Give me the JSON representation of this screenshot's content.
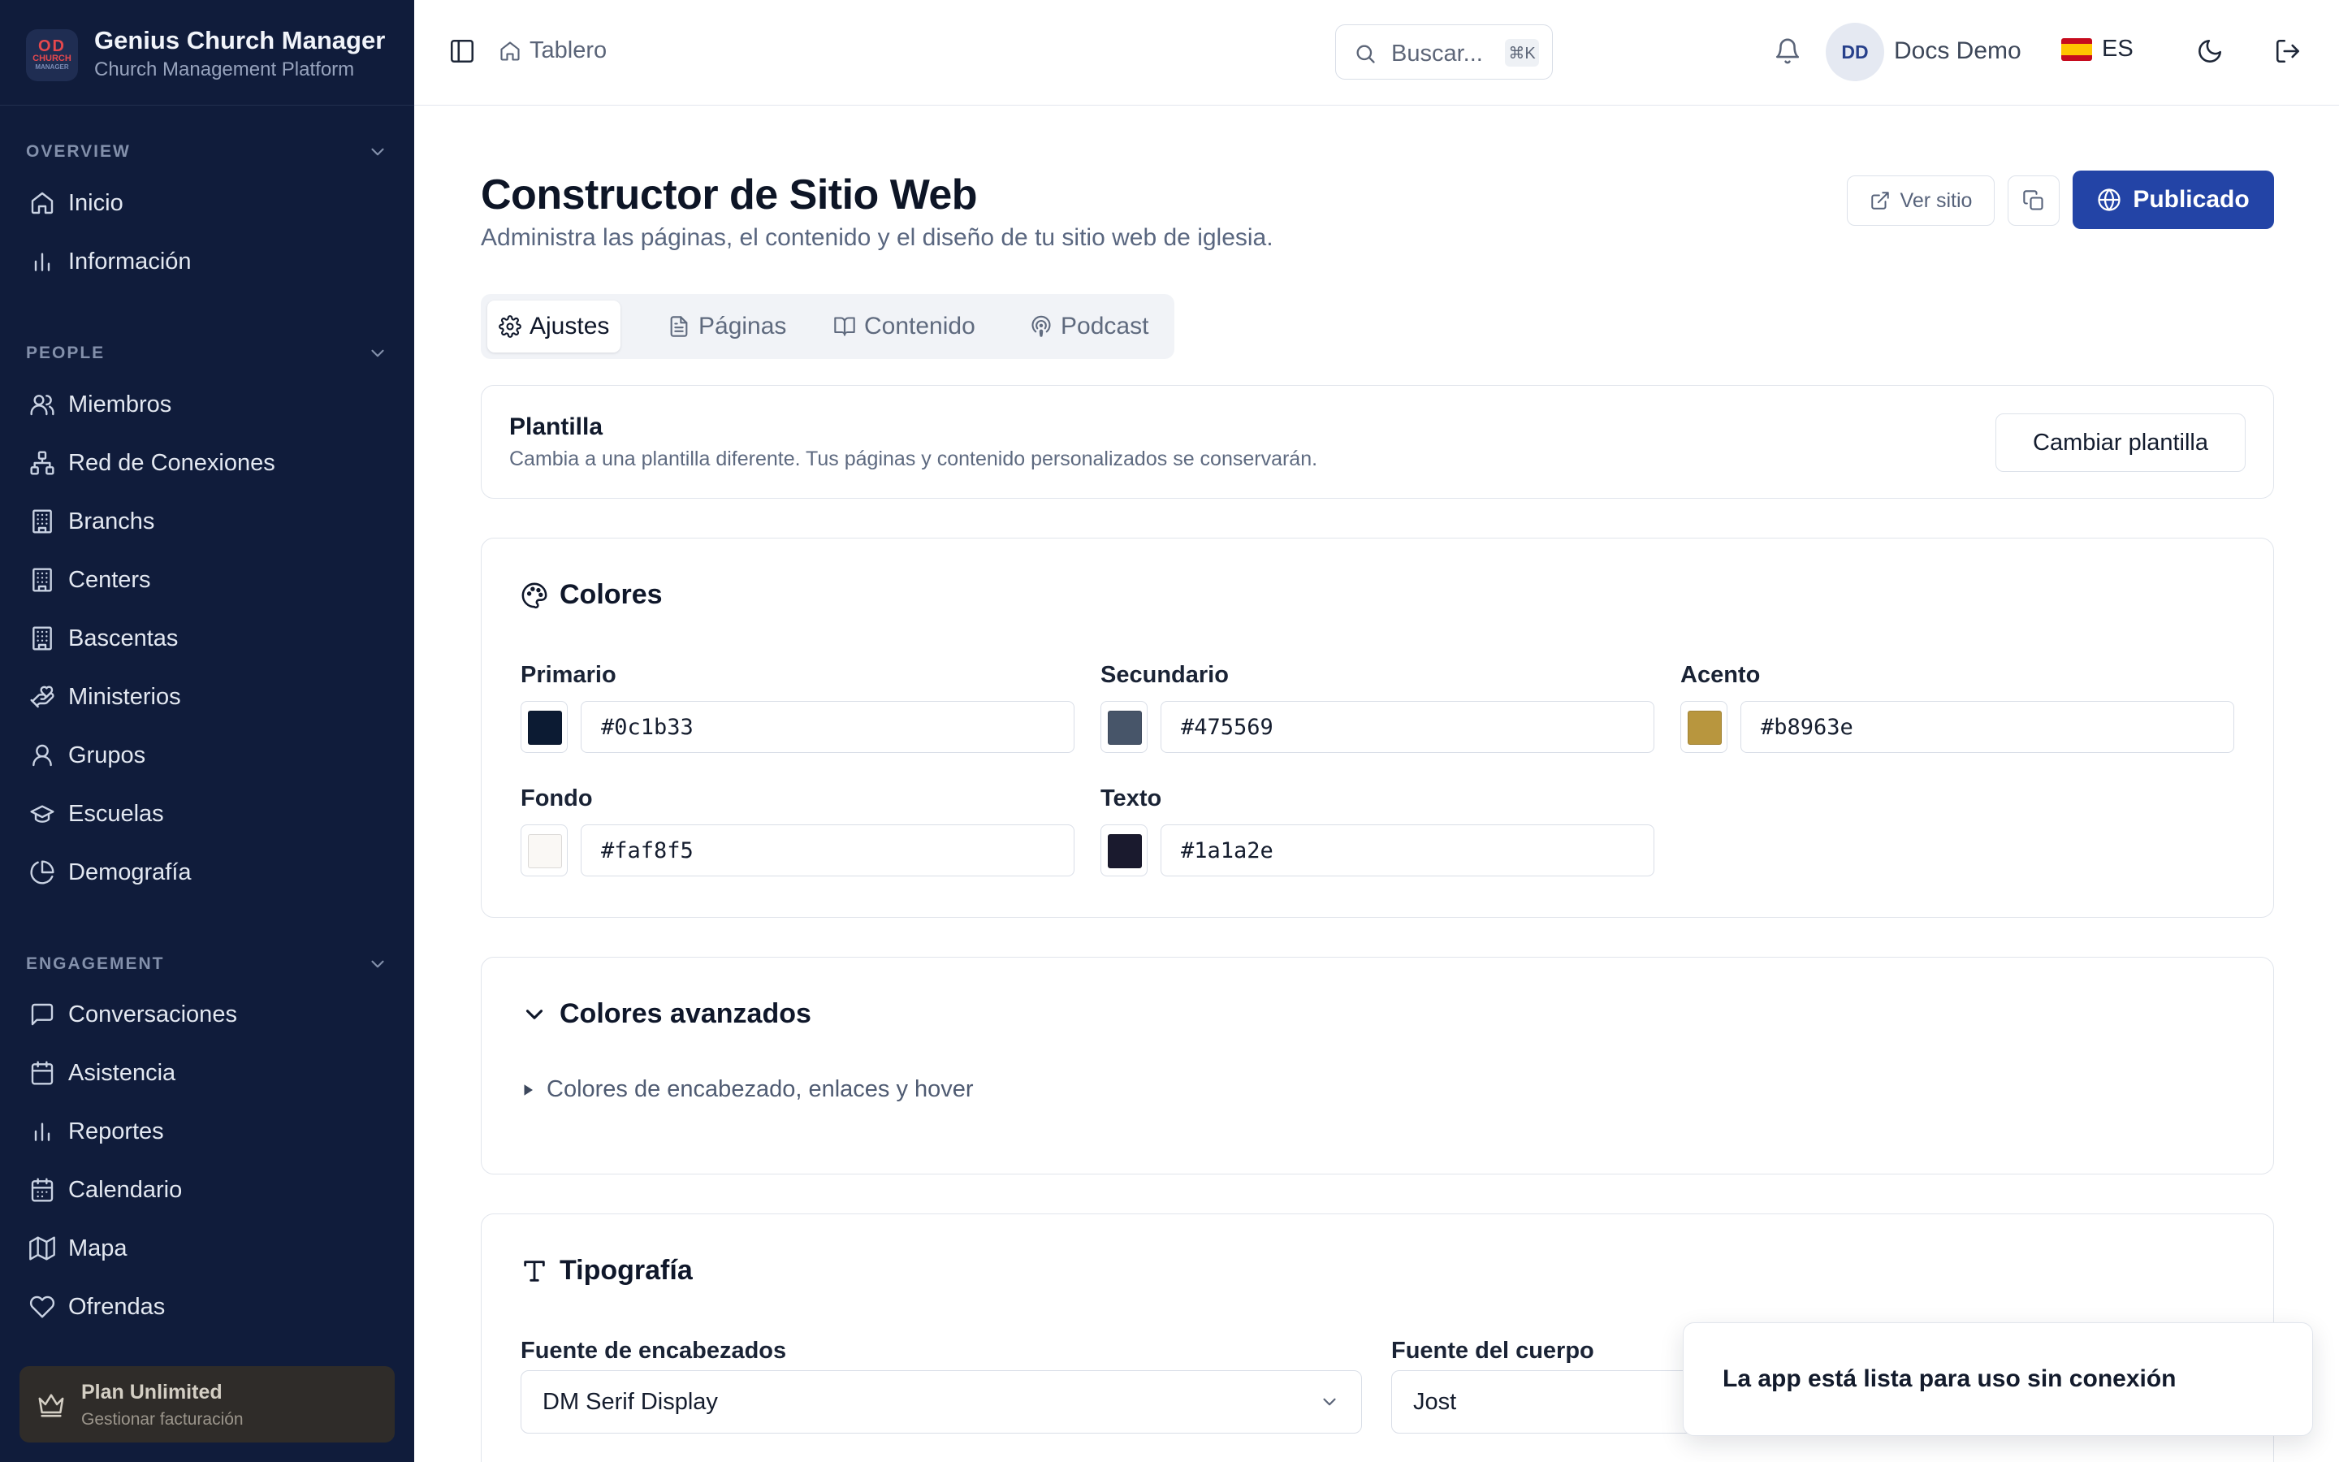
{
  "brand": {
    "logo_top": "OD",
    "logo_mid": "CHURCH",
    "logo_bottom": "MANAGER",
    "name": "Genius Church Manager",
    "subtitle": "Church Management Platform"
  },
  "sidebar": {
    "sections": [
      {
        "title": "OVERVIEW",
        "items": [
          {
            "label": "Inicio",
            "icon": "home-icon"
          },
          {
            "label": "Información",
            "icon": "bar-chart-icon"
          }
        ]
      },
      {
        "title": "PEOPLE",
        "items": [
          {
            "label": "Miembros",
            "icon": "users-icon"
          },
          {
            "label": "Red de Conexiones",
            "icon": "network-icon"
          },
          {
            "label": "Branchs",
            "icon": "building-icon"
          },
          {
            "label": "Centers",
            "icon": "building-icon"
          },
          {
            "label": "Bascentas",
            "icon": "building-icon"
          },
          {
            "label": "Ministerios",
            "icon": "hand-heart-icon"
          },
          {
            "label": "Grupos",
            "icon": "group-icon"
          },
          {
            "label": "Escuelas",
            "icon": "graduation-cap-icon"
          },
          {
            "label": "Demografía",
            "icon": "pie-chart-icon"
          }
        ]
      },
      {
        "title": "ENGAGEMENT",
        "items": [
          {
            "label": "Conversaciones",
            "icon": "message-square-icon"
          },
          {
            "label": "Asistencia",
            "icon": "calendar-check-icon"
          },
          {
            "label": "Reportes",
            "icon": "bar-chart-icon"
          },
          {
            "label": "Calendario",
            "icon": "calendar-icon"
          },
          {
            "label": "Mapa",
            "icon": "map-icon"
          },
          {
            "label": "Ofrendas",
            "icon": "heart-icon"
          }
        ]
      }
    ],
    "plan": {
      "title": "Plan Unlimited",
      "subtitle": "Gestionar facturación",
      "icon": "crown-icon"
    }
  },
  "topbar": {
    "breadcrumb": "Tablero",
    "search_placeholder": "Buscar...",
    "search_shortcut": "⌘K",
    "avatar_initials": "DD",
    "user_name": "Docs Demo",
    "language": "ES"
  },
  "page": {
    "title": "Constructor de Sitio Web",
    "subtitle": "Administra las páginas, el contenido y el diseño de tu sitio web de iglesia.",
    "view_site_label": "Ver sitio",
    "publish_label": "Publicado"
  },
  "tabs": [
    {
      "label": "Ajustes",
      "icon": "settings-icon",
      "active": true
    },
    {
      "label": "Páginas",
      "icon": "file-text-icon",
      "active": false
    },
    {
      "label": "Contenido",
      "icon": "book-open-icon",
      "active": false
    },
    {
      "label": "Podcast",
      "icon": "podcast-icon",
      "active": false
    }
  ],
  "template_card": {
    "title": "Plantilla",
    "subtitle": "Cambia a una plantilla diferente. Tus páginas y contenido personalizados se conservarán.",
    "button_label": "Cambiar plantilla"
  },
  "colors_card": {
    "title": "Colores",
    "fields": [
      {
        "label": "Primario",
        "value": "#0c1b33"
      },
      {
        "label": "Secundario",
        "value": "#475569"
      },
      {
        "label": "Acento",
        "value": "#b8963e"
      },
      {
        "label": "Fondo",
        "value": "#faf8f5"
      },
      {
        "label": "Texto",
        "value": "#1a1a2e"
      }
    ]
  },
  "advanced_card": {
    "title": "Colores avanzados",
    "summary": "Colores de encabezado, enlaces y hover"
  },
  "typography_card": {
    "title": "Tipografía",
    "heading_font_label": "Fuente de encabezados",
    "heading_font_value": "DM Serif Display",
    "body_font_label": "Fuente del cuerpo",
    "body_font_value": "Jost"
  },
  "toast": {
    "message": "La app está lista para uso sin conexión"
  },
  "theme": {
    "sidebar_bg": "#101c3b",
    "accent": "#2344a6"
  }
}
